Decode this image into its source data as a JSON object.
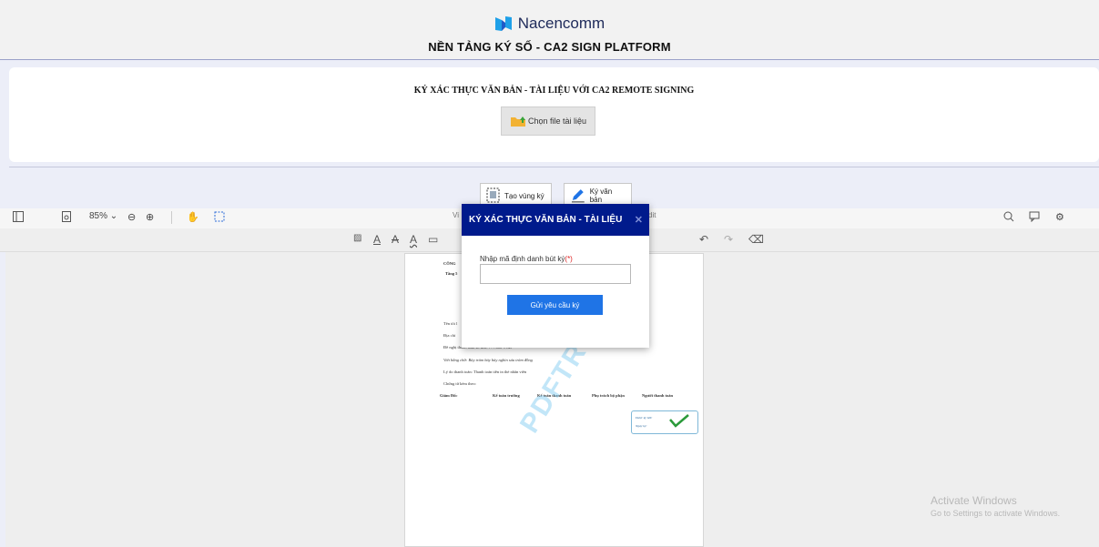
{
  "header": {
    "brand": "Nacencomm",
    "platform_title": "NỀN TẢNG KÝ SỐ - CA2 SIGN PLATFORM"
  },
  "upload": {
    "title": "KÝ XÁC THỰC VĂN BẢN - TÀI LIỆU VỚI CA2 REMOTE SIGNING",
    "choose_button": "Chọn file tài liệu"
  },
  "sign_toolbar": {
    "create_area": "Tạo vùng ký",
    "sign_doc": "Ký văn bản"
  },
  "viewer": {
    "zoom": "85%",
    "tab_view": "Vi",
    "tab_edit": "dit"
  },
  "pdf": {
    "lines": [
      "CÔNG",
      "Tầng 5",
      "Tên tôi l",
      "Địa chỉ",
      "Đề nghị thanh toán số tiền:   777.000        VND",
      "Viết bằng chữ: Bảy trăm bảy bảy nghìn sáu trăm đồng",
      "Lý do thanh toán: Thanh toán tiền in thẻ nhân viên",
      "Chứng từ kèm theo:",
      "Giám Đốc",
      "Kế toán trưởng",
      "Kế toán thanh toán",
      "Phụ trách bộ phận",
      "Người thanh toán"
    ],
    "stamp_line1": "Được ký bởi:",
    "stamp_line2": "Ngày ký:",
    "watermark": "PDFTRON"
  },
  "modal": {
    "title": "KÝ XÁC THỰC VĂN BẢN - TÀI LIỆU",
    "label": "Nhập mã định danh bút ký",
    "required": "(*)",
    "input_value": "",
    "submit": "Gửi yêu cầu ký"
  },
  "os_watermark": {
    "line1": "Activate Windows",
    "line2": "Go to Settings to activate Windows."
  },
  "colors": {
    "modal_header": "#001a8c",
    "primary_button": "#1f74e6",
    "brand": "#1e2a5a"
  }
}
